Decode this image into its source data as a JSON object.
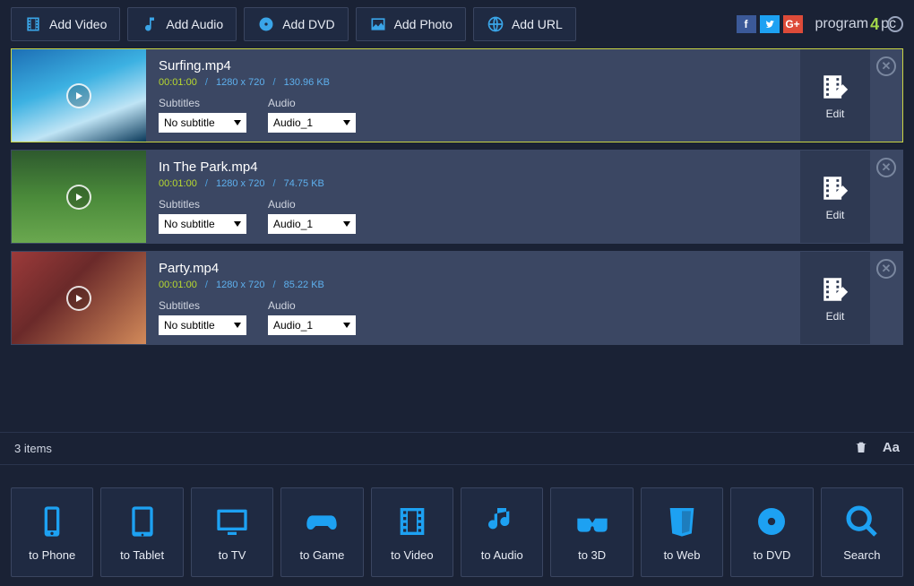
{
  "topbar": {
    "buttons": [
      {
        "label": "Add Video"
      },
      {
        "label": "Add Audio"
      },
      {
        "label": "Add DVD"
      },
      {
        "label": "Add Photo"
      },
      {
        "label": "Add URL"
      }
    ]
  },
  "brand": {
    "part1": "program",
    "accent": "4",
    "part2": "pc"
  },
  "items": [
    {
      "name": "Surfing.mp4",
      "duration": "00:01:00",
      "resolution": "1280 x 720",
      "size": "130.96 KB",
      "subtitle_label": "Subtitles",
      "audio_label": "Audio",
      "subtitle_value": "No subtitle",
      "audio_value": "Audio_1",
      "edit_label": "Edit"
    },
    {
      "name": "In The Park.mp4",
      "duration": "00:01:00",
      "resolution": "1280 x 720",
      "size": "74.75 KB",
      "subtitle_label": "Subtitles",
      "audio_label": "Audio",
      "subtitle_value": "No subtitle",
      "audio_value": "Audio_1",
      "edit_label": "Edit"
    },
    {
      "name": "Party.mp4",
      "duration": "00:01:00",
      "resolution": "1280 x 720",
      "size": "85.22 KB",
      "subtitle_label": "Subtitles",
      "audio_label": "Audio",
      "subtitle_value": "No subtitle",
      "audio_value": "Audio_1",
      "edit_label": "Edit"
    }
  ],
  "status": {
    "count_text": "3  items"
  },
  "bottombar": {
    "targets": [
      {
        "label": "to Phone"
      },
      {
        "label": "to Tablet"
      },
      {
        "label": "to TV"
      },
      {
        "label": "to Game"
      },
      {
        "label": "to Video"
      },
      {
        "label": "to Audio"
      },
      {
        "label": "to 3D"
      },
      {
        "label": "to Web"
      },
      {
        "label": "to DVD"
      },
      {
        "label": "Search"
      }
    ]
  },
  "separator": "/"
}
